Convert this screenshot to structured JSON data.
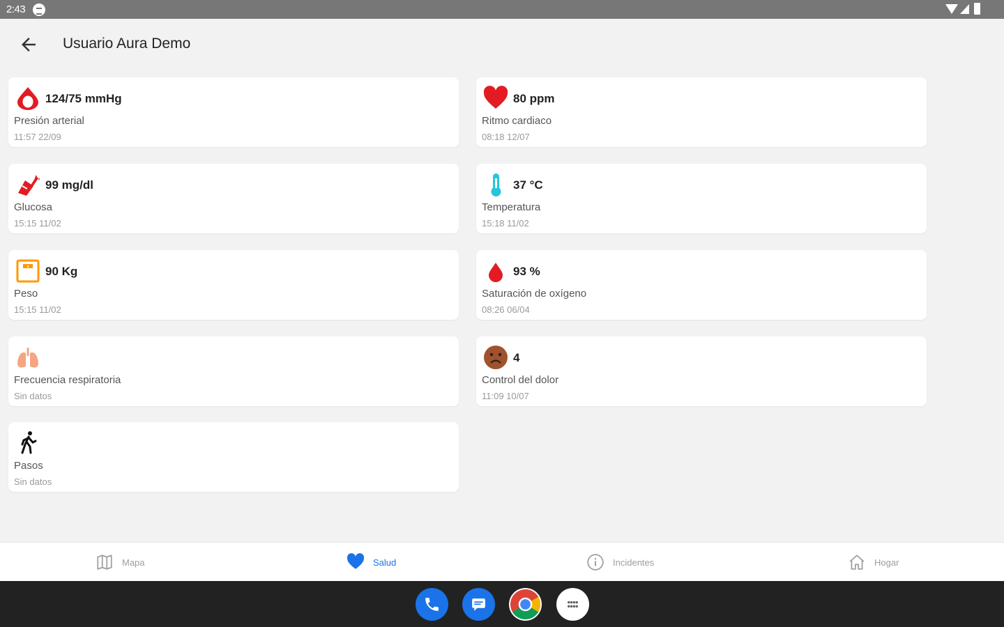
{
  "status_bar": {
    "time": "2:43"
  },
  "header": {
    "title": "Usuario Aura Demo",
    "back_icon": "arrow-back-icon"
  },
  "cards": [
    {
      "id": "blood-pressure",
      "icon": "blood-drop-icon",
      "value": "124/75 mmHg",
      "label": "Presión arterial",
      "date": "11:57 22/09"
    },
    {
      "id": "heart-rate",
      "icon": "heart-icon",
      "value": "80 ppm",
      "label": "Ritmo cardiaco",
      "date": "08:18 12/07"
    },
    {
      "id": "glucose",
      "icon": "glucose-icon",
      "value": "99 mg/dl",
      "label": "Glucosa",
      "date": "15:15 11/02"
    },
    {
      "id": "temperature",
      "icon": "thermometer-icon",
      "value": "37 °C",
      "label": "Temperatura",
      "date": "15:18 11/02"
    },
    {
      "id": "weight",
      "icon": "scale-icon",
      "value": "90 Kg",
      "label": "Peso",
      "date": "15:15 11/02"
    },
    {
      "id": "oxygen",
      "icon": "oxygen-drop-icon",
      "value": "93 %",
      "label": "Saturación de oxígeno",
      "date": "08:26 06/04"
    },
    {
      "id": "respiratory",
      "icon": "lungs-icon",
      "value": "",
      "label": "Frecuencia respiratoria",
      "date": "Sin datos"
    },
    {
      "id": "pain",
      "icon": "sad-face-icon",
      "value": "4",
      "label": "Control del dolor",
      "date": "11:09 10/07"
    },
    {
      "id": "steps",
      "icon": "walking-icon",
      "value": "",
      "label": "Pasos",
      "date": "Sin datos"
    }
  ],
  "bottom_nav": [
    {
      "id": "map",
      "label": "Mapa",
      "icon": "map-icon",
      "active": false
    },
    {
      "id": "health",
      "label": "Salud",
      "icon": "heart-icon",
      "active": true
    },
    {
      "id": "incidents",
      "label": "Incidentes",
      "icon": "info-icon",
      "active": false
    },
    {
      "id": "home",
      "label": "Hogar",
      "icon": "home-icon",
      "active": false
    }
  ],
  "dock": [
    {
      "id": "phone",
      "icon": "phone-icon"
    },
    {
      "id": "messages",
      "icon": "messages-icon"
    },
    {
      "id": "chrome",
      "icon": "chrome-icon"
    },
    {
      "id": "apps",
      "icon": "app-drawer-icon"
    }
  ],
  "colors": {
    "active": "#1a73e8",
    "red": "#e31b23",
    "orange": "#ff9800",
    "teal": "#26c6da",
    "brown": "#a0522d"
  }
}
